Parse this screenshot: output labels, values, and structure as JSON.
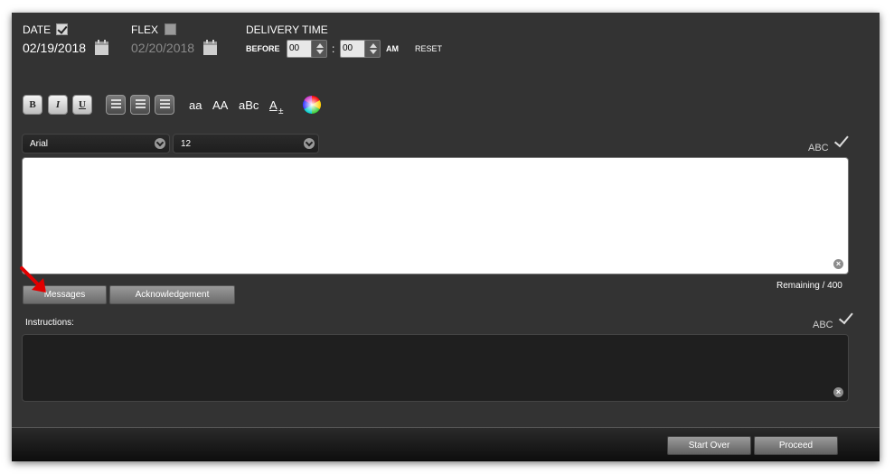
{
  "delivery": {
    "date_label": "DATE",
    "date_checked": true,
    "date_value": "02/19/2018",
    "flex_label": "FLEX",
    "flex_checked": false,
    "flex_value": "02/20/2018",
    "delivery_time_label": "DELIVERY TIME",
    "before_label": "BEFORE",
    "hour_value": "00",
    "separator": ":",
    "minute_value": "00",
    "ampm": "AM",
    "reset_label": "RESET"
  },
  "toolbar": {
    "bold": "B",
    "italic": "I",
    "underline": "U",
    "lowercase": "aa",
    "uppercase": "AA",
    "camelcase": "aBc",
    "font_size_glyph": "A",
    "font_family": "Arial",
    "font_size": "12"
  },
  "message": {
    "spellcheck_label": "ABC",
    "remaining_text": "Remaining / 400",
    "tab_messages": "Messages",
    "tab_acknowledgement": "Acknowledgement",
    "clear_glyph": "×"
  },
  "instructions": {
    "label": "Instructions:",
    "spellcheck_label": "ABC",
    "clear_glyph": "×"
  },
  "footer": {
    "start_over": "Start Over",
    "proceed": "Proceed"
  },
  "colors": {
    "panel_bg": "#333333",
    "annotation_arrow": "#e00000"
  }
}
